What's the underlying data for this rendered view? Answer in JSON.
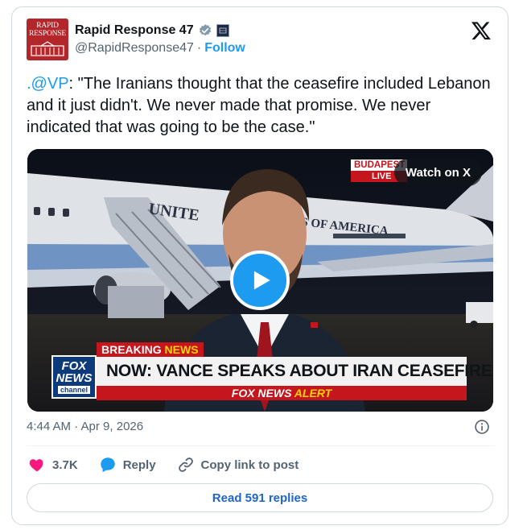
{
  "author": {
    "display_name": "Rapid Response 47",
    "handle": "@RapidResponse47",
    "separator": "·",
    "follow_label": "Follow",
    "avatar_text_line1": "RAPID",
    "avatar_text_line2": "RESPONSE"
  },
  "tweet": {
    "mention": ".@VP",
    "text": ": \"The Iranians thought that the ceasefire included Lebanon and it just didn't. We never made that promise. We never indicated that was going to be the case.\""
  },
  "video": {
    "watch_label": "Watch on X",
    "location_bug": "BUDAPEST",
    "location_sub": "LIVE",
    "plane_text": "UNITED STATES OF AMERICA",
    "fox_logo_line1": "FOX",
    "fox_logo_line2": "NEWS",
    "fox_logo_line3": "channel",
    "breaking_label": "BREAKING",
    "breaking_news": " NEWS",
    "headline": "NOW: VANCE SPEAKS ABOUT IRAN CEASEFIRE",
    "alert_prefix": "FOX NEWS",
    "alert_suffix": " ALERT"
  },
  "meta": {
    "timestamp": "4:44 AM · Apr 9, 2026"
  },
  "actions": {
    "like_count": "3.7K",
    "reply_label": "Reply",
    "copy_label": "Copy link to post"
  },
  "read_replies_label": "Read 591 replies",
  "colors": {
    "accent": "#1d9bf0",
    "like": "#f91880",
    "fox_red": "#c4161c",
    "fox_blue": "#0d3a7a",
    "avatar_red": "#b3262a"
  },
  "icons": [
    "verified-badge-icon",
    "affiliate-badge-icon",
    "x-logo-icon",
    "play-icon",
    "info-icon",
    "heart-icon",
    "reply-bubble-icon",
    "link-icon"
  ]
}
